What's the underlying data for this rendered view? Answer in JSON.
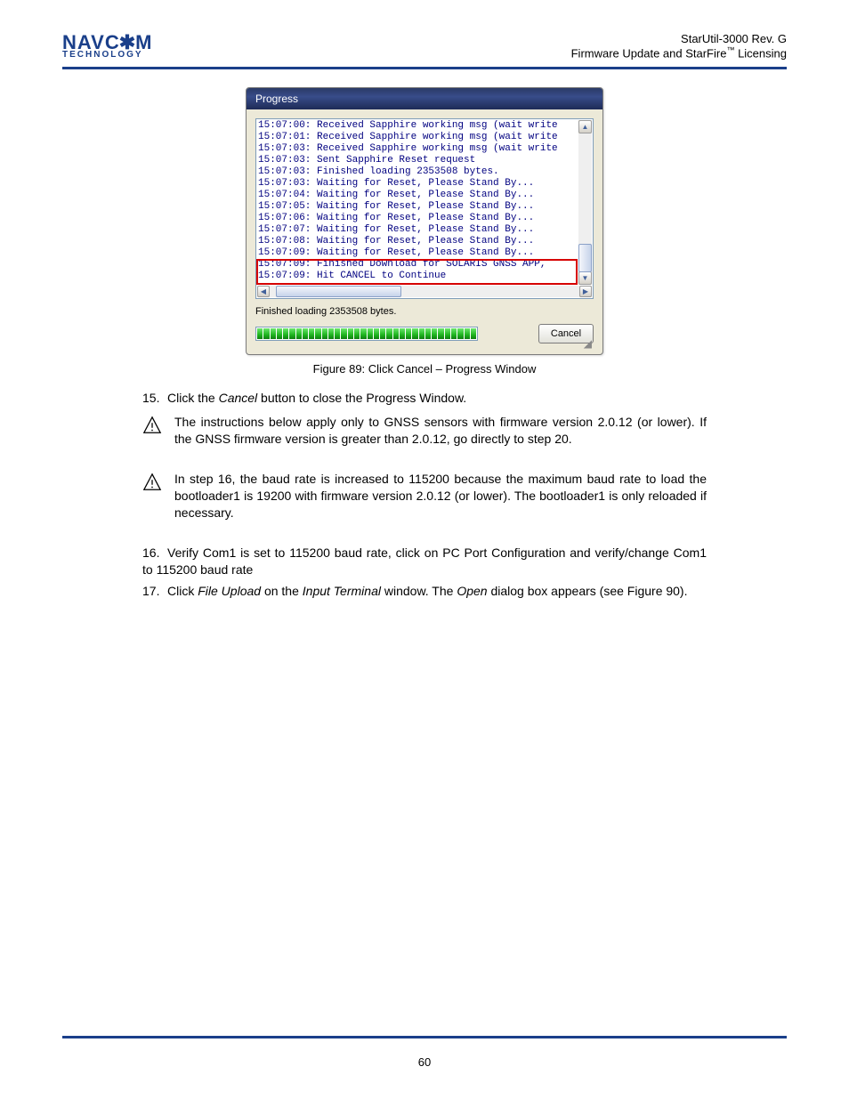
{
  "header": {
    "logo_top": "NAVC✱M",
    "logo_bottom": "TECHNOLOGY",
    "right_1": "StarUtil-3000 Rev. G",
    "right_2": "Firmware Update and StarFire",
    "right_tm": "™",
    "right_3": " Licensing"
  },
  "dialog": {
    "title": "Progress",
    "log_lines": [
      "15:07:00: Received Sapphire working msg (wait write",
      "15:07:01: Received Sapphire working msg (wait write",
      "15:07:03: Received Sapphire working msg (wait write",
      "15:07:03: Sent Sapphire Reset request",
      "15:07:03: Finished loading 2353508 bytes.",
      "15:07:03: Waiting for Reset, Please Stand By...",
      "15:07:04: Waiting for Reset, Please Stand By...",
      "15:07:05: Waiting for Reset, Please Stand By...",
      "15:07:06: Waiting for Reset, Please Stand By...",
      "15:07:07: Waiting for Reset, Please Stand By...",
      "15:07:08: Waiting for Reset, Please Stand By...",
      "15:07:09: Waiting for Reset, Please Stand By...",
      "15:07:09: Finished Download for SOLARIS  GNSS APP,",
      "15:07:09: Hit CANCEL to Continue"
    ],
    "status": "Finished loading 2353508 bytes.",
    "cancel": "Cancel"
  },
  "figure_caption": "Figure 89: Click Cancel – Progress Window",
  "step15": {
    "num": "15.",
    "text_a": "Click the ",
    "ital": "Cancel",
    "text_b": " button to close the Progress Window."
  },
  "note1": "The instructions below apply only to GNSS sensors with firmware version 2.0.12 (or lower). If the GNSS firmware version is greater than 2.0.12, go directly to step 20.",
  "note2": "In step 16, the baud rate is increased to 115200 because the maximum baud rate to load the bootloader1 is 19200 with firmware version 2.0.12 (or lower). The bootloader1 is only reloaded if necessary.",
  "step16": {
    "num": "16.",
    "text": "Verify Com1 is set to 115200 baud rate, click on PC Port Configuration and verify/change Com1 to 115200 baud rate"
  },
  "step17": {
    "num": "17.",
    "text_a": "Click ",
    "ital1": "File Upload",
    "text_b": " on the ",
    "ital2": "Input Terminal",
    "text_c": " window. The ",
    "ital3": "Open",
    "text_d": " dialog box appears (see Figure 90)."
  },
  "footer": "60"
}
